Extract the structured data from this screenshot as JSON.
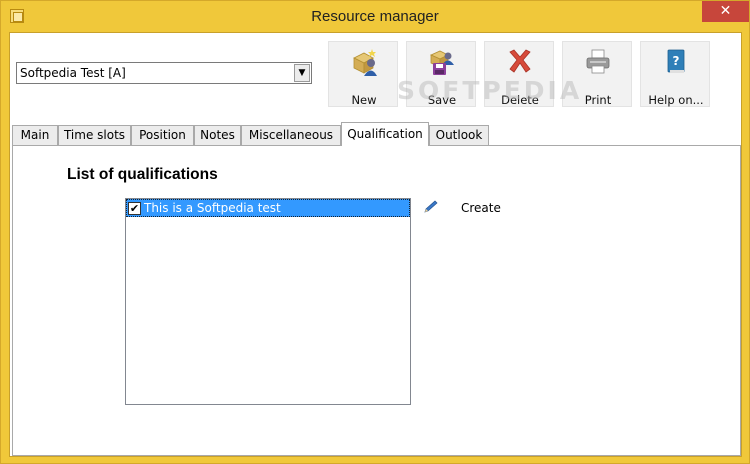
{
  "window": {
    "title": "Resource manager",
    "close_glyph": "✕"
  },
  "resource_select": {
    "value": "Softpedia Test [A]",
    "arrow_glyph": "▼"
  },
  "toolbar": {
    "items": [
      {
        "label": "New",
        "icon": "new-resource-icon"
      },
      {
        "label": "Save",
        "icon": "save-icon"
      },
      {
        "label": "Delete",
        "icon": "delete-icon"
      },
      {
        "label": "Print",
        "icon": "print-icon"
      },
      {
        "label": "Help on...",
        "icon": "help-book-icon"
      }
    ]
  },
  "watermark": "SOFTPEDIA",
  "tabs": [
    {
      "label": "Main"
    },
    {
      "label": "Time slots"
    },
    {
      "label": "Position"
    },
    {
      "label": "Notes"
    },
    {
      "label": "Miscellaneous"
    },
    {
      "label": "Qualification",
      "active": true
    },
    {
      "label": "Outlook"
    }
  ],
  "qualification_panel": {
    "heading": "List of qualifications",
    "items": [
      {
        "label": "This is a Softpedia test",
        "checked": true,
        "check_glyph": "✔"
      }
    ],
    "create_label": "Create"
  },
  "colors": {
    "title_bar": "#f0c83a",
    "close_button": "#c7463b",
    "selection": "#3399ff"
  }
}
